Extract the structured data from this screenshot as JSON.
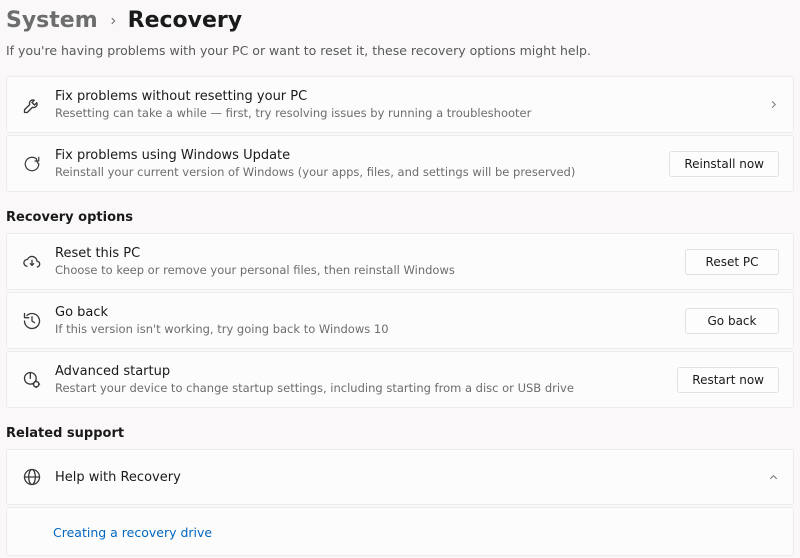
{
  "breadcrumb": {
    "parent": "System",
    "current": "Recovery"
  },
  "subtitle": "If you're having problems with your PC or want to reset it, these recovery options might help.",
  "top": [
    {
      "title": "Fix problems without resetting your PC",
      "desc": "Resetting can take a while — first, try resolving issues by running a troubleshooter"
    },
    {
      "title": "Fix problems using Windows Update",
      "desc": "Reinstall your current version of Windows (your apps, files, and settings will be preserved)",
      "button": "Reinstall now"
    }
  ],
  "recovery": {
    "heading": "Recovery options",
    "items": [
      {
        "title": "Reset this PC",
        "desc": "Choose to keep or remove your personal files, then reinstall Windows",
        "button": "Reset PC"
      },
      {
        "title": "Go back",
        "desc": "If this version isn't working, try going back to Windows 10",
        "button": "Go back"
      },
      {
        "title": "Advanced startup",
        "desc": "Restart your device to change startup settings, including starting from a disc or USB drive",
        "button": "Restart now"
      }
    ]
  },
  "support": {
    "heading": "Related support",
    "title": "Help with Recovery",
    "link": "Creating a recovery drive"
  }
}
